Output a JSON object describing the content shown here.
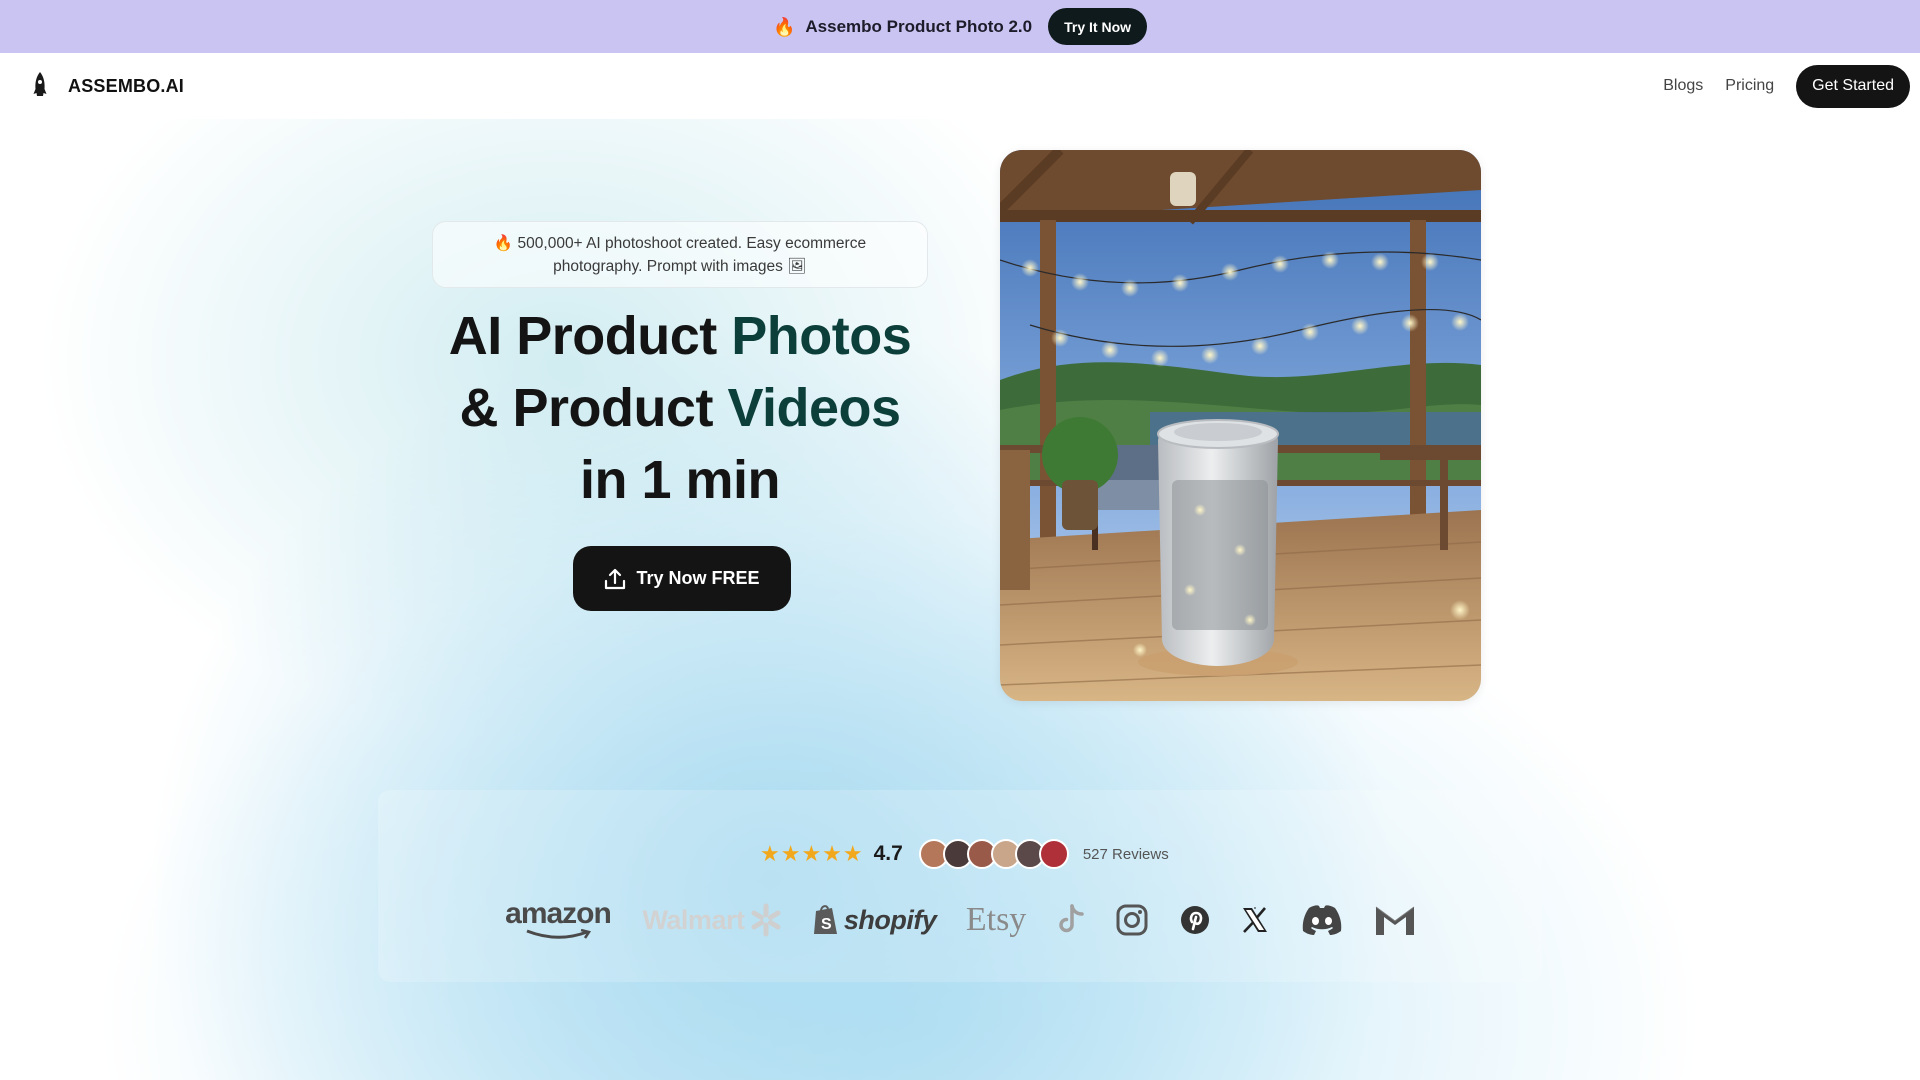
{
  "announcement": {
    "flame_icon": "flame-icon",
    "text": "Assembo Product Photo 2.0",
    "button_label": "Try It Now"
  },
  "nav": {
    "brand": "ASSEMBO.AI",
    "logo_icon": "rocket-icon",
    "links": [
      "Blogs",
      "Pricing"
    ],
    "cta_label": "Get Started"
  },
  "hero": {
    "tagline_line1": "500,000+ AI photoshoot created. Easy ecommerce",
    "tagline_line2": "photography. Prompt with images",
    "headline": {
      "part1": "AI Product ",
      "accent1": "Photos",
      "part2": "& Product ",
      "accent2": "Videos",
      "part3": "in 1 min"
    },
    "cta_label": "Try Now FREE",
    "cta_icon": "upload-icon",
    "image_description_icon": "product-photo-image"
  },
  "social_proof": {
    "stars": "★★★★★",
    "rating": "4.7",
    "reviews": "527 Reviews",
    "avatar_count": 6,
    "logos": {
      "amazon": "amazon",
      "walmart": "Walmart",
      "shopify": "shopify",
      "etsy": "Etsy"
    }
  },
  "colors": {
    "announcement_bg": "#c9c4f2",
    "accent_text": "#0d3f3a",
    "star": "#f2a81d",
    "dark_button": "#141414"
  }
}
